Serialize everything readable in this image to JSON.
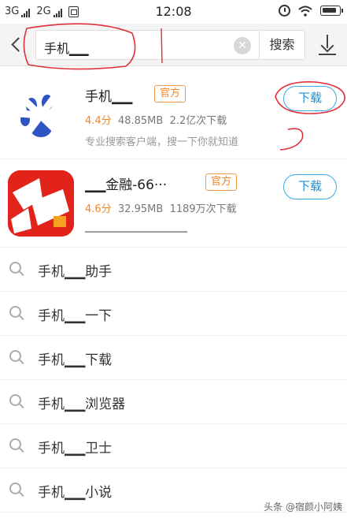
{
  "status_bar": {
    "network_1": "3G",
    "network_2": "2G",
    "time": "12:08"
  },
  "search": {
    "query": "手机▁▁",
    "clear_symbol": "✕",
    "button_label": "搜索"
  },
  "apps": [
    {
      "name": "手机▁▁",
      "badge": "官方",
      "rating": "4.4分",
      "size": "48.85MB",
      "downloads": "2.2亿次下载",
      "description": "专业搜索客户端，搜一下你就知道",
      "button_label": "下载"
    },
    {
      "name": "▁▁金融-66···",
      "badge": "官方",
      "rating": "4.6分",
      "size": "32.95MB",
      "downloads": "1189万次下载",
      "description": "▁▁▁▁▁▁▁▁▁▁▁▁▁",
      "button_label": "下载"
    }
  ],
  "suggestions": [
    "手机▁▁助手",
    "手机▁▁一下",
    "手机▁▁下载",
    "手机▁▁浏览器",
    "手机▁▁卫士",
    "手机▁▁小说"
  ],
  "watermark": "头条 @宿颜小阿姨",
  "colors": {
    "accent_blue": "#1d8fd6",
    "badge_orange": "#f0862a",
    "annotation_red": "#e0303a"
  }
}
